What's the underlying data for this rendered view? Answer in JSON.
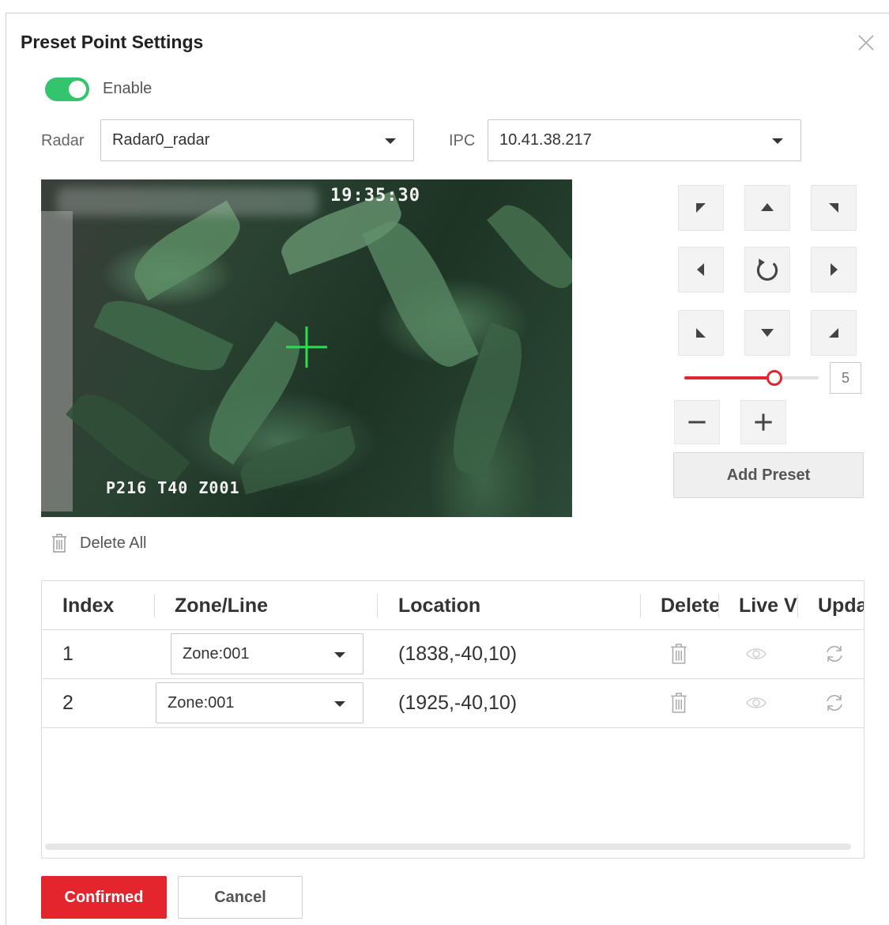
{
  "dialog": {
    "title": "Preset Point Settings"
  },
  "enable": {
    "label": "Enable",
    "checked": true
  },
  "radar": {
    "label": "Radar",
    "value": "Radar0_radar"
  },
  "ipc": {
    "label": "IPC",
    "value": "10.41.38.217"
  },
  "video": {
    "timestamp": "19:35:30",
    "osd_text": "P216 T40  Z001"
  },
  "ptz": {
    "speed": "5",
    "speed_level": 0.67,
    "add_preset_label": "Add Preset"
  },
  "delete_all_label": "Delete All",
  "table": {
    "columns": [
      "Index",
      "Zone/Line",
      "Location",
      "Delete",
      "Live V",
      "Upda"
    ],
    "rows": [
      {
        "index": "1",
        "zone": "Zone:001",
        "location": "(1838,-40,10)"
      },
      {
        "index": "2",
        "zone": "Zone:001",
        "location": "(1925,-40,10)"
      }
    ]
  },
  "footer": {
    "confirm_label": "Confirmed",
    "cancel_label": "Cancel"
  },
  "colors": {
    "accent_red": "#e3252e",
    "toggle_green": "#34c46e"
  }
}
